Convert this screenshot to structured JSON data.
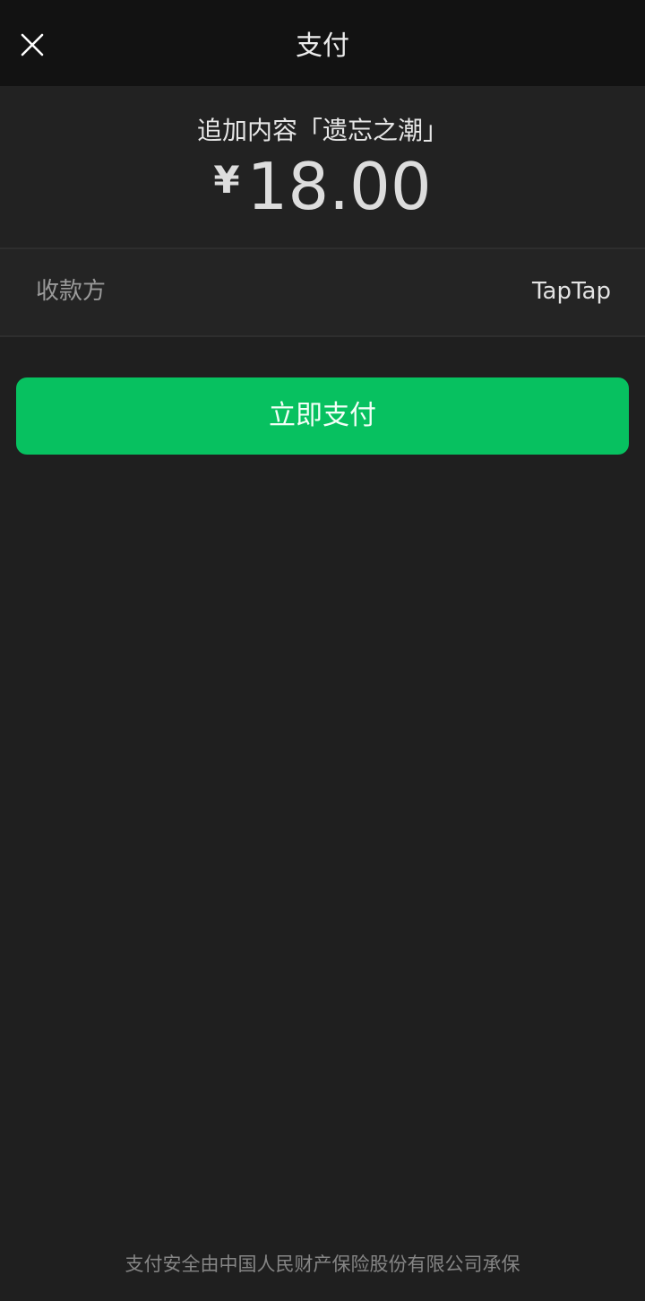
{
  "header": {
    "title": "支付",
    "close_icon": "close-icon"
  },
  "order": {
    "product_name": "追加内容「遗忘之潮」",
    "currency_symbol": "¥",
    "amount": "18.00"
  },
  "payee": {
    "label": "收款方",
    "value": "TapTap"
  },
  "actions": {
    "pay_label": "立即支付"
  },
  "footer": {
    "note": "支付安全由中国人民财产保险股份有限公司承保"
  },
  "colors": {
    "accent": "#07c160",
    "background": "#1f1f1f",
    "header_background": "#121212"
  }
}
